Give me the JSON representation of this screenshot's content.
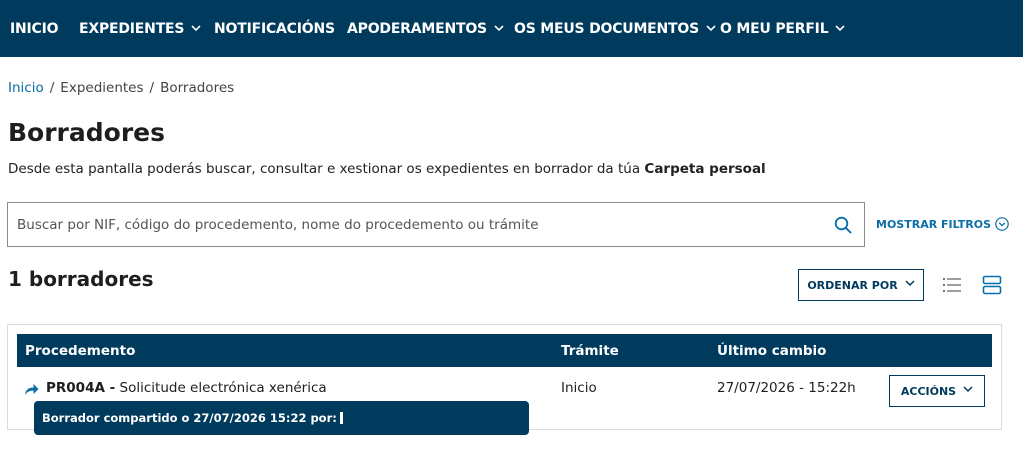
{
  "nav": {
    "items": [
      {
        "label": "INICIO",
        "has_dropdown": false
      },
      {
        "label": "EXPEDIENTES",
        "has_dropdown": true
      },
      {
        "label": "NOTIFICACIÓNS",
        "has_dropdown": false
      },
      {
        "label": "APODERAMENTOS",
        "has_dropdown": true
      },
      {
        "label": "OS MEUS DOCUMENTOS",
        "has_dropdown": true
      },
      {
        "label": "O MEU PERFIL",
        "has_dropdown": true
      }
    ]
  },
  "breadcrumb": {
    "items": [
      "Inicio",
      "Expedientes",
      "Borradores"
    ],
    "separator": "/"
  },
  "page": {
    "title": "Borradores",
    "description_prefix": "Desde esta pantalla poderás buscar, consultar e xestionar os expedientes en borrador da túa",
    "description_bold": "Carpeta persoal"
  },
  "search": {
    "placeholder": "Buscar por NIF, código do procedemento, nome do procedemento ou trámite",
    "value": "",
    "filters_label": "MOSTRAR FILTROS"
  },
  "results": {
    "count_label": "1 borradores",
    "sort_label": "ORDENAR POR",
    "columns": [
      "Procedemento",
      "Trámite",
      "Último cambio"
    ],
    "rows": [
      {
        "code": "PR004A -",
        "name": "Solicitude electrónica xenérica",
        "tramite": "Inicio",
        "last_change": "27/07/2026 - 15:22h",
        "actions_label": "ACCIÓNS",
        "tooltip": "Borrador compartido o 27/07/2026 15:22 por:"
      }
    ]
  },
  "icons": {
    "search": "search-icon",
    "list_view": "list-view-icon",
    "card_view": "card-view-icon",
    "share": "share-arrow-icon",
    "chevron": "chevron-down-icon"
  },
  "colors": {
    "nav_background": "#003a5d",
    "link": "#0b6ea8",
    "table_header": "#003a5d",
    "border": "#dcdcdc"
  }
}
